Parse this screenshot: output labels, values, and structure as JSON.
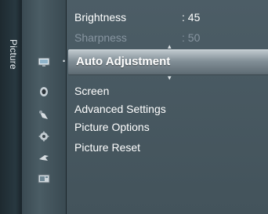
{
  "rail": {
    "title": "Picture"
  },
  "menu": {
    "brightness": {
      "label": "Brightness",
      "value": ": 45"
    },
    "sharpness": {
      "label": "Sharpness",
      "value": ": 50"
    },
    "selected": {
      "label": "Auto Adjustment"
    },
    "items": [
      {
        "label": "Screen"
      },
      {
        "label": "Advanced Settings"
      },
      {
        "label": "Picture Options"
      },
      {
        "label": "Picture Reset"
      }
    ]
  },
  "icons": [
    "picture-icon",
    "sound-icon",
    "setup-icon",
    "settings-icon",
    "input-icon",
    "application-icon"
  ]
}
